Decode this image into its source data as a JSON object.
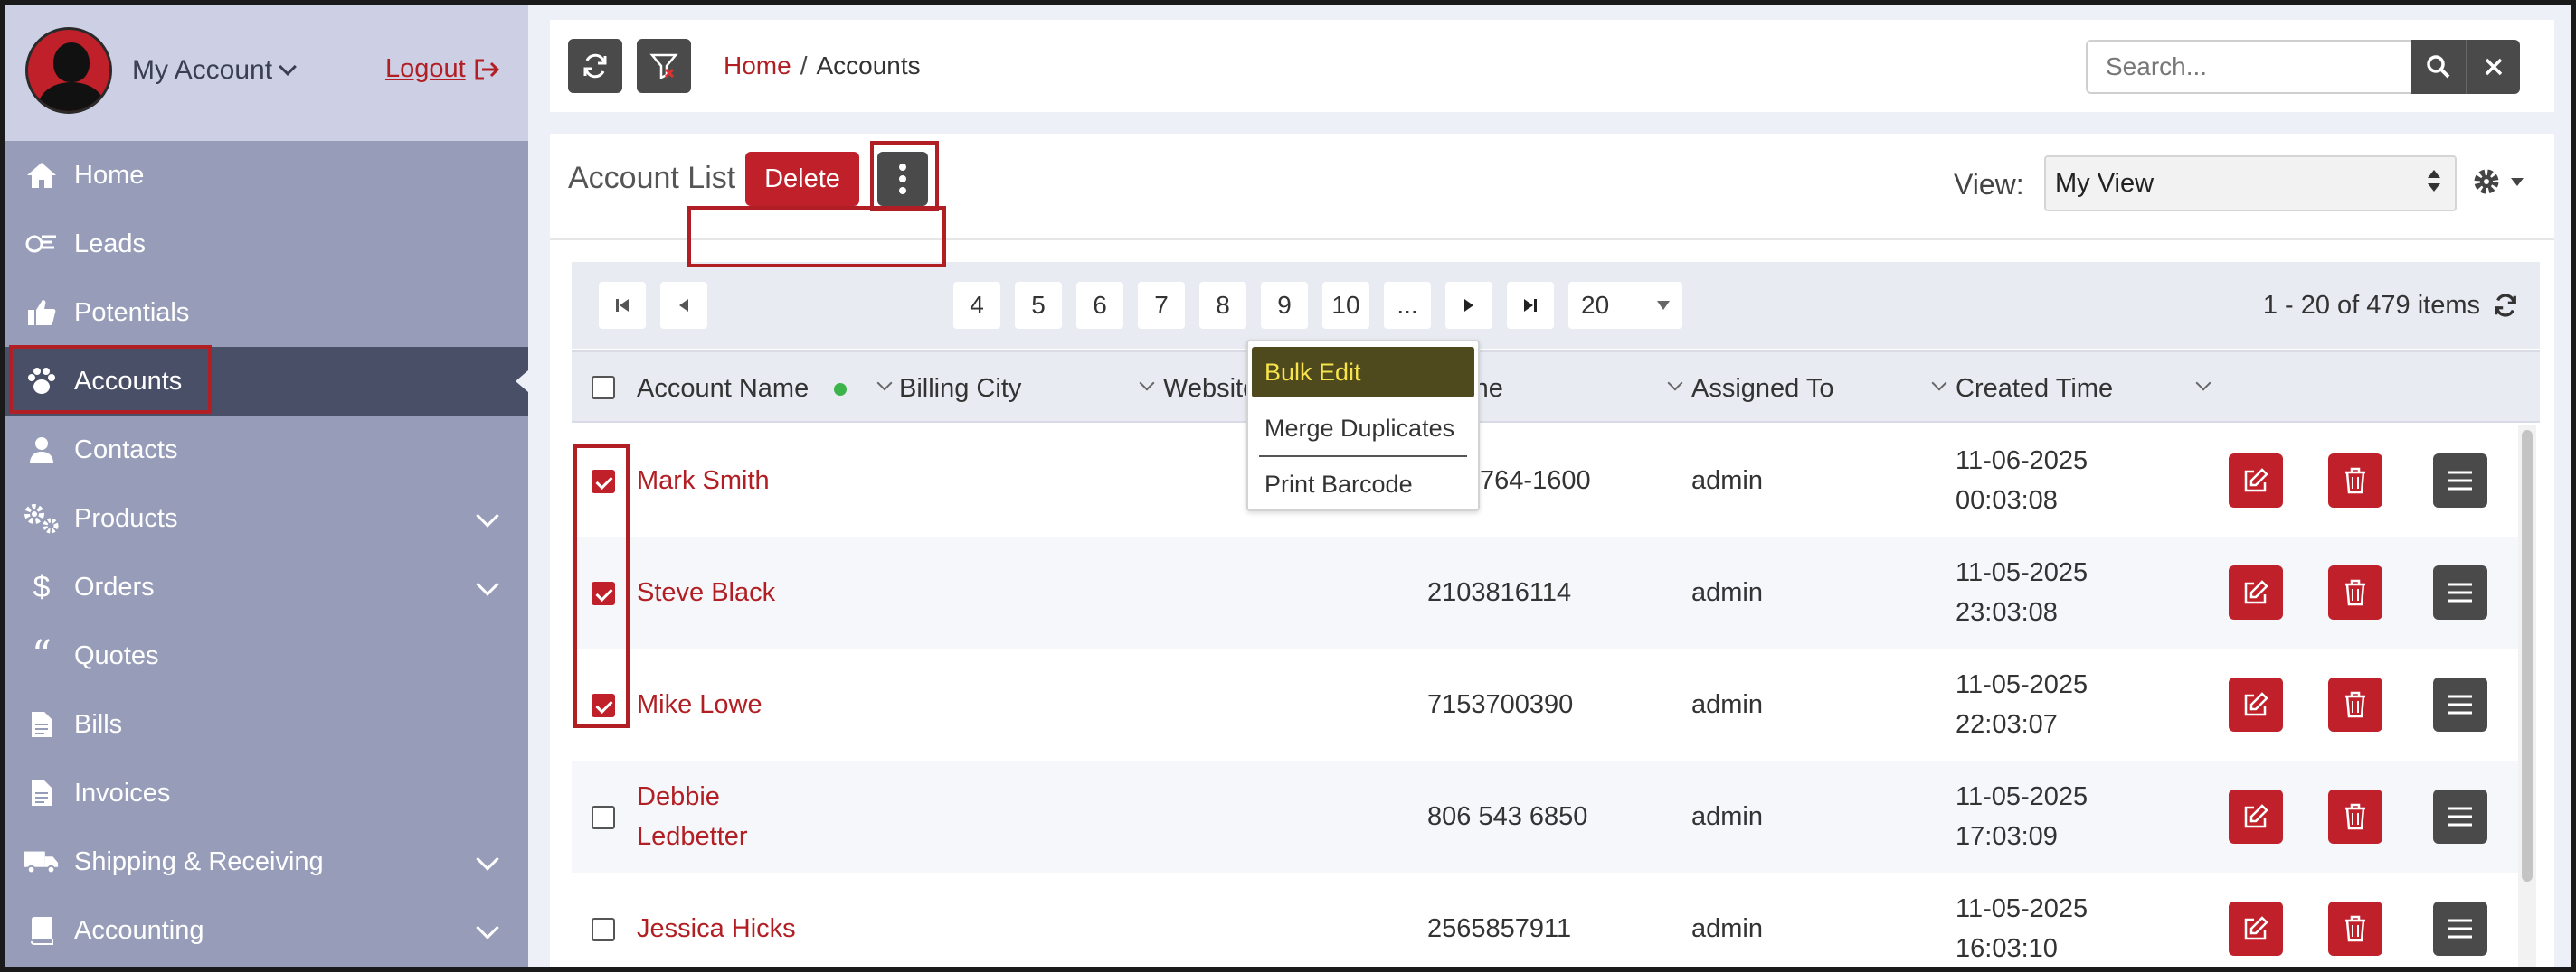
{
  "account_menu": {
    "label": "My Account",
    "logout": "Logout"
  },
  "sidebar": {
    "items": [
      {
        "label": "Home",
        "icon": "home-icon"
      },
      {
        "label": "Leads",
        "icon": "leads-icon"
      },
      {
        "label": "Potentials",
        "icon": "thumbs-up-icon"
      },
      {
        "label": "Accounts",
        "icon": "paw-icon",
        "active": true
      },
      {
        "label": "Contacts",
        "icon": "user-icon"
      },
      {
        "label": "Products",
        "icon": "gears-icon",
        "expandable": true
      },
      {
        "label": "Orders",
        "icon": "dollar-icon",
        "expandable": true
      },
      {
        "label": "Quotes",
        "icon": "quote-icon"
      },
      {
        "label": "Bills",
        "icon": "document-icon"
      },
      {
        "label": "Invoices",
        "icon": "document-icon"
      },
      {
        "label": "Shipping & Receiving",
        "icon": "truck-icon",
        "expandable": true
      },
      {
        "label": "Accounting",
        "icon": "book-icon",
        "expandable": true
      }
    ]
  },
  "breadcrumb": {
    "home": "Home",
    "separator": "/",
    "current": "Accounts"
  },
  "search": {
    "placeholder": "Search...",
    "value": ""
  },
  "list": {
    "title": "Account List",
    "delete_label": "Delete",
    "more_menu": [
      "Bulk Edit",
      "Merge Duplicates",
      "Print Barcode"
    ],
    "view_label": "View:",
    "view_value": "My View"
  },
  "pager": {
    "pages": [
      "4",
      "5",
      "6",
      "7",
      "8",
      "9",
      "10",
      "..."
    ],
    "page_size": "20",
    "count_text": "1 - 20 of 479 items"
  },
  "table": {
    "columns": [
      "Account Name",
      "Billing City",
      "Website",
      "Phone",
      "Assigned To",
      "Created Time"
    ],
    "rows": [
      {
        "checked": true,
        "name": [
          "Mark Smith"
        ],
        "city": "",
        "website": "",
        "phone": "845-764-1600",
        "assigned": "admin",
        "created": [
          "11-06-2025",
          "00:03:08"
        ]
      },
      {
        "checked": true,
        "name": [
          "Steve Black"
        ],
        "city": "",
        "website": "",
        "phone": "2103816114",
        "assigned": "admin",
        "created": [
          "11-05-2025",
          "23:03:08"
        ]
      },
      {
        "checked": true,
        "name": [
          "Mike Lowe"
        ],
        "city": "",
        "website": "",
        "phone": "7153700390",
        "assigned": "admin",
        "created": [
          "11-05-2025",
          "22:03:07"
        ]
      },
      {
        "checked": false,
        "name": [
          "Debbie",
          "Ledbetter"
        ],
        "city": "",
        "website": "",
        "phone": "806 543 6850",
        "assigned": "admin",
        "created": [
          "11-05-2025",
          "17:03:09"
        ]
      },
      {
        "checked": false,
        "name": [
          "Jessica Hicks"
        ],
        "city": "",
        "website": "",
        "phone": "2565857911",
        "assigned": "admin",
        "created": [
          "11-05-2025",
          "16:03:10"
        ]
      }
    ]
  },
  "colors": {
    "accent_red": "#c0202a",
    "sidebar_bg": "#979db8",
    "sidebar_active": "#4a4f68",
    "bulk_edit_bg": "#4e4a1e",
    "bulk_edit_text": "#f7e34a"
  }
}
